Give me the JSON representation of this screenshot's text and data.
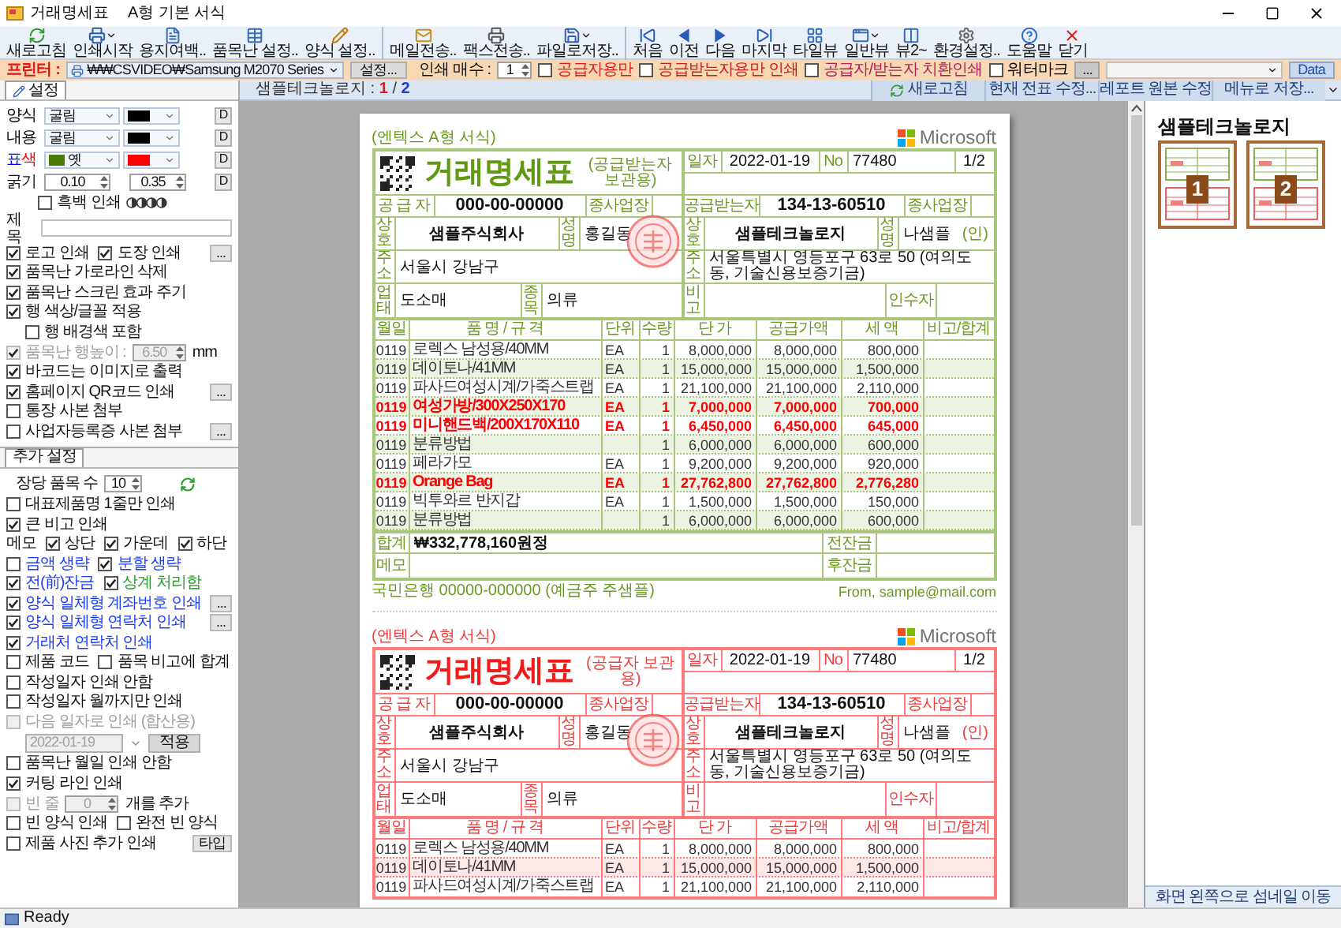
{
  "window": {
    "title": "거래명세표",
    "subtitle": "A형 기본 서식"
  },
  "toolbar": [
    [
      {
        "label": "새로고침",
        "kind": "refresh",
        "dropdown": false
      },
      {
        "label": "인쇄시작",
        "kind": "printer",
        "dropdown": true
      },
      {
        "label": "용지여백..",
        "kind": "page",
        "dropdown": false
      },
      {
        "label": "품목난 설정..",
        "kind": "grid",
        "dropdown": false
      },
      {
        "label": "양식 설정..",
        "kind": "pencil",
        "dropdown": false
      }
    ],
    [
      {
        "label": "메일전송..",
        "kind": "mail",
        "dropdown": false
      },
      {
        "label": "팩스전송..",
        "kind": "fax",
        "dropdown": false
      },
      {
        "label": "파일로저장..",
        "kind": "save",
        "dropdown": true
      }
    ],
    [
      {
        "label": "처음",
        "kind": "first",
        "dropdown": false
      },
      {
        "label": "이전",
        "kind": "prev",
        "dropdown": false
      },
      {
        "label": "다음",
        "kind": "next",
        "dropdown": false
      },
      {
        "label": "마지막",
        "kind": "last",
        "dropdown": false
      },
      {
        "label": "타일뷰",
        "kind": "tile",
        "dropdown": false
      },
      {
        "label": "일반뷰",
        "kind": "normal",
        "dropdown": true
      },
      {
        "label": "뷰2~",
        "kind": "view2",
        "dropdown": false
      },
      {
        "label": "환경설정..",
        "kind": "gear",
        "dropdown": false
      },
      {
        "label": "도움말",
        "kind": "help",
        "dropdown": false
      },
      {
        "label": "닫기",
        "kind": "close",
        "dropdown": false
      }
    ]
  ],
  "printer_bar": {
    "label": "프린터 :",
    "printer": "₩₩CSVIDEO₩Samsung M2070 Series",
    "settings_button": "설정...",
    "copies_label": "인쇄 매수 :",
    "copies": "1",
    "options": [
      {
        "label": "공급자용만",
        "checked": false,
        "color": "#e01818"
      },
      {
        "label": "공급받는자용만 인쇄",
        "checked": false,
        "color": "#c81e1e"
      },
      {
        "label": "공급자/받는자 치환인쇄",
        "checked": false,
        "color": "#b0205a"
      },
      {
        "label": "워터마크",
        "checked": false,
        "color": "#000000"
      }
    ],
    "more_button": "...",
    "data_button": "Data"
  },
  "settings": {
    "tab": {
      "label": "설정",
      "selected": true
    },
    "style_rows": [
      {
        "kind": "font",
        "label_parts": [
          {
            "text": "양식",
            "color": "#000000"
          }
        ],
        "font": "굴림",
        "color": "#000000",
        "reset": "D"
      },
      {
        "kind": "font",
        "label_parts": [
          {
            "text": "내용",
            "color": "#000000"
          }
        ],
        "font": "굴림",
        "color": "#000000",
        "reset": "D"
      },
      {
        "kind": "swatch",
        "label_parts": [
          {
            "text": "표",
            "color": "#0000ff"
          },
          {
            "text": "색",
            "color": "#ff0000"
          }
        ],
        "fill": {
          "color": "#4a7a0a",
          "label": "옛"
        },
        "color": "#ff0000",
        "reset": "D"
      }
    ],
    "thickness": {
      "label": "굵기",
      "values": [
        "0.10",
        "0.35"
      ],
      "reset": "D"
    },
    "bw_print": {
      "label": "흑백 인쇄",
      "checked": false
    },
    "title_field": {
      "label": "제목"
    },
    "rows": [
      {
        "kind": "checks",
        "items": [
          {
            "label": "로고 인쇄",
            "checked": true
          },
          {
            "label": "도장 인쇄",
            "checked": true
          }
        ],
        "button": "..."
      },
      {
        "kind": "checks",
        "items": [
          {
            "label": "품목난 가로라인 삭제",
            "checked": true
          }
        ]
      },
      {
        "kind": "checks",
        "items": [
          {
            "label": "품목난 스크린 효과 주기",
            "checked": true
          }
        ]
      },
      {
        "kind": "checks",
        "items": [
          {
            "label": "행 색상/글꼴 적용",
            "checked": true
          }
        ],
        "children": [
          {
            "kind": "checks",
            "items": [
              {
                "label": "행 배경색 포함",
                "checked": false
              }
            ]
          }
        ]
      },
      {
        "kind": "spin",
        "check": {
          "label": "품목난 행높이 :",
          "checked": true
        },
        "value": "6.50",
        "unit": "mm",
        "disabled": true
      },
      {
        "kind": "checks",
        "items": [
          {
            "label": "바코드는 이미지로 출력",
            "checked": true
          }
        ]
      },
      {
        "kind": "checks",
        "items": [
          {
            "label": "홈페이지 QR코드 인쇄",
            "checked": true
          }
        ],
        "button": "..."
      },
      {
        "kind": "checks",
        "items": [
          {
            "label": "통장 사본 첨부",
            "checked": false
          }
        ]
      },
      {
        "kind": "checks",
        "items": [
          {
            "label": "사업자등록증 사본 첨부",
            "checked": false
          }
        ],
        "button": "..."
      }
    ]
  },
  "extra": {
    "tab": {
      "label": "추가 설정",
      "selected": true
    },
    "per_page": {
      "label": "장당 품목 수",
      "value": "10"
    },
    "rows": [
      {
        "kind": "checks",
        "items": [
          {
            "label": "대표제품명 1줄만 인쇄",
            "checked": false
          }
        ]
      },
      {
        "kind": "checks",
        "items": [
          {
            "label": "큰 비고 인쇄",
            "checked": true
          }
        ]
      },
      {
        "kind": "checks",
        "label": "메모",
        "items": [
          {
            "label": "상단",
            "checked": true
          },
          {
            "label": "가운데",
            "checked": true
          },
          {
            "label": "하단",
            "checked": true
          }
        ]
      },
      {
        "kind": "checks",
        "items": [
          {
            "label": "금액 생략",
            "checked": false,
            "color": "#1a3cff"
          },
          {
            "label": "분할 생략",
            "checked": true,
            "color": "#1a3cff"
          }
        ]
      },
      {
        "kind": "checks",
        "items": [
          {
            "label": "전(前)잔금",
            "checked": true,
            "color": "#1a3cff"
          },
          {
            "label": "상계 처리함",
            "checked": true,
            "color": "#2a9a2a"
          }
        ]
      },
      {
        "kind": "checks",
        "items": [
          {
            "label": "양식 일체형 계좌번호 인쇄",
            "checked": true,
            "color": "#1a3cff"
          }
        ],
        "button": "..."
      },
      {
        "kind": "checks",
        "items": [
          {
            "label": "양식 일체형 연락처 인쇄",
            "checked": true,
            "color": "#1a3cff"
          }
        ],
        "button": "..."
      },
      {
        "kind": "checks",
        "items": [
          {
            "label": "거래처 연락처 인쇄",
            "checked": true,
            "color": "#1a3cff"
          }
        ]
      },
      {
        "kind": "checks",
        "items": [
          {
            "label": "제품 코드",
            "checked": false
          },
          {
            "label": "품목 비고에 합계",
            "checked": false
          }
        ]
      },
      {
        "kind": "checks",
        "items": [
          {
            "label": "작성일자 인쇄 안함",
            "checked": false
          }
        ]
      },
      {
        "kind": "checks",
        "items": [
          {
            "label": "작성일자 월까지만 인쇄",
            "checked": false
          }
        ]
      },
      {
        "kind": "date",
        "check": {
          "label": "다음 일자로 인쇄 (합산용)",
          "checked": false
        },
        "value": "2022-01-19",
        "button": "적용",
        "disabled": true
      },
      {
        "kind": "checks",
        "items": [
          {
            "label": "품목난 월일 인쇄 안함",
            "checked": false
          }
        ]
      },
      {
        "kind": "checks",
        "items": [
          {
            "label": "커팅 라인 인쇄",
            "checked": true
          }
        ]
      },
      {
        "kind": "spin",
        "check": {
          "label": "빈 줄",
          "checked": false
        },
        "value": "0",
        "unit": "개를 추가",
        "disabled": true
      },
      {
        "kind": "checks",
        "items": [
          {
            "label": "빈 양식 인쇄",
            "checked": false
          },
          {
            "label": "완전 빈 양식",
            "checked": false
          }
        ]
      },
      {
        "kind": "checks",
        "items": [
          {
            "label": "제품 사진 추가 인쇄",
            "checked": false
          }
        ],
        "button": "타입"
      }
    ]
  },
  "viewer": {
    "header": {
      "company": "샘플테크놀로지 :",
      "current": "1",
      "separator": "/",
      "total": "2"
    },
    "buttons": [
      {
        "label": "새로고침",
        "kind": "refresh"
      },
      {
        "label": "현재 전표 수정..."
      },
      {
        "label": "레포트 원본 수정"
      },
      {
        "label": "메뉴로 저장..."
      }
    ]
  },
  "invoices": [
    {
      "kind": "green",
      "form_label": "(엔텍스 A형 서식)",
      "logo": "Microsoft",
      "title": "거래명세표",
      "copy_label": "(공급받는자 보관용)",
      "head": {
        "date_label": "일자",
        "date": "2022-01-19",
        "no_label": "No",
        "no": "77480",
        "page": "1/2"
      },
      "supplier": {
        "label": "공 급 자",
        "reg": "000-00-00000",
        "biz_label": "종사업장",
        "name_label": "상호",
        "name": "샘플주식회사",
        "rep_label": "성명",
        "rep": "홍길동",
        "addr_label": "주소",
        "addr": "서울시 강남구",
        "type_label": "업태",
        "type": "도소매",
        "item_label": "종목",
        "item": "의류"
      },
      "receiver": {
        "label": "공급받는자",
        "reg": "134-13-60510",
        "biz_label": "종사업장",
        "name_label": "상호",
        "name": "샘플테크놀로지",
        "rep_label": "성명",
        "rep": "나샘플",
        "seal": "(인)",
        "addr_label": "주소",
        "addr": "서울특별시 영등포구 63로 50 (여의도동, 기술신용보증기금)",
        "note_label": "비고",
        "receiver_label": "인수자"
      },
      "columns": [
        "월일",
        "품 명 / 규 격",
        "단위",
        "수량",
        "단 가",
        "공급가액",
        "세 액",
        "비고/합계"
      ],
      "rows": [
        {
          "date": "0119",
          "name": "로렉스 남성용/40MM",
          "unit": "EA",
          "qty": "1",
          "price": "8,000,000",
          "amount": "8,000,000",
          "tax": "800,000",
          "highlight": false
        },
        {
          "date": "0119",
          "name": "데이토나/41MM",
          "unit": "EA",
          "qty": "1",
          "price": "15,000,000",
          "amount": "15,000,000",
          "tax": "1,500,000",
          "highlight": false
        },
        {
          "date": "0119",
          "name": "파사드여성시계/가죽스트랩",
          "unit": "EA",
          "qty": "1",
          "price": "21,100,000",
          "amount": "21,100,000",
          "tax": "2,110,000",
          "highlight": false
        },
        {
          "date": "0119",
          "name": "여성가방/300X250X170",
          "unit": "EA",
          "qty": "1",
          "price": "7,000,000",
          "amount": "7,000,000",
          "tax": "700,000",
          "highlight": true
        },
        {
          "date": "0119",
          "name": "미니핸드백/200X170X110",
          "unit": "EA",
          "qty": "1",
          "price": "6,450,000",
          "amount": "6,450,000",
          "tax": "645,000",
          "highlight": true
        },
        {
          "date": "0119",
          "name": "분류방법",
          "qty": "1",
          "price": "6,000,000",
          "amount": "6,000,000",
          "tax": "600,000",
          "highlight": false
        },
        {
          "date": "0119",
          "name": "페라가모",
          "unit": "EA",
          "qty": "1",
          "price": "9,200,000",
          "amount": "9,200,000",
          "tax": "920,000",
          "highlight": false
        },
        {
          "date": "0119",
          "name": "Orange Bag",
          "unit": "EA",
          "qty": "1",
          "price": "27,762,800",
          "amount": "27,762,800",
          "tax": "2,776,280",
          "highlight": true
        },
        {
          "date": "0119",
          "name": "빅투와르 반지갑",
          "unit": "EA",
          "qty": "1",
          "price": "1,500,000",
          "amount": "1,500,000",
          "tax": "150,000",
          "highlight": false
        },
        {
          "date": "0119",
          "name": "분류방법",
          "qty": "1",
          "price": "6,000,000",
          "amount": "6,000,000",
          "tax": "600,000",
          "highlight": false
        }
      ],
      "totals": {
        "total_label": "합계",
        "total": "₩332,778,160원정",
        "prev_label": "전잔금",
        "memo_label": "메모",
        "after_label": "후잔금"
      },
      "footer": {
        "bank": "국민은행 00000-000000 (예금주 주샘플)",
        "from": "From,  sample@mail.com"
      }
    },
    {
      "kind": "red",
      "form_label": "(엔텍스 A형 서식)",
      "logo": "Microsoft",
      "title": "거래명세표",
      "copy_label": "(공급자 보관용)",
      "head": {
        "date_label": "일자",
        "date": "2022-01-19",
        "no_label": "No",
        "no": "77480",
        "page": "1/2"
      },
      "supplier": {
        "label": "공 급 자",
        "reg": "000-00-00000",
        "biz_label": "종사업장",
        "name_label": "상호",
        "name": "샘플주식회사",
        "rep_label": "성명",
        "rep": "홍길동",
        "addr_label": "주소",
        "addr": "서울시 강남구",
        "type_label": "업태",
        "type": "도소매",
        "item_label": "종목",
        "item": "의류"
      },
      "receiver": {
        "label": "공급받는자",
        "reg": "134-13-60510",
        "biz_label": "종사업장",
        "name_label": "상호",
        "name": "샘플테크놀로지",
        "rep_label": "성명",
        "rep": "나샘플",
        "seal": "(인)",
        "addr_label": "주소",
        "addr": "서울특별시 영등포구 63로 50 (여의도동, 기술신용보증기금)",
        "note_label": "비고",
        "receiver_label": "인수자"
      },
      "columns": [
        "월일",
        "품 명 / 규 격",
        "단위",
        "수량",
        "단 가",
        "공급가액",
        "세 액",
        "비고/합계"
      ],
      "rows": [
        {
          "date": "0119",
          "name": "로렉스 남성용/40MM",
          "unit": "EA",
          "qty": "1",
          "price": "8,000,000",
          "amount": "8,000,000",
          "tax": "800,000",
          "highlight": false
        },
        {
          "date": "0119",
          "name": "데이토나/41MM",
          "unit": "EA",
          "qty": "1",
          "price": "15,000,000",
          "amount": "15,000,000",
          "tax": "1,500,000",
          "highlight": false
        },
        {
          "date": "0119",
          "name": "파사드여성시계/가죽스트랩",
          "unit": "EA",
          "qty": "1",
          "price": "21,100,000",
          "amount": "21,100,000",
          "tax": "2,110,000",
          "highlight": false
        }
      ]
    }
  ],
  "thumbnails": {
    "title": "샘플테크놀로지",
    "pages": [
      {
        "label": "1"
      },
      {
        "label": "2"
      }
    ],
    "move_button": "화면 왼쪽으로 섬네일 이동"
  },
  "status_bar": {
    "text": "Ready"
  }
}
